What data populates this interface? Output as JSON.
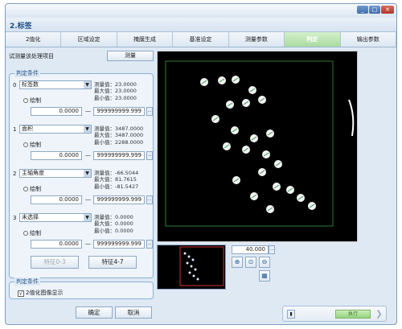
{
  "window": {
    "title": "2.标签",
    "controls": [
      "_",
      "□",
      "✕"
    ]
  },
  "tabs": [
    {
      "label": "2值化",
      "active": false
    },
    {
      "label": "区域设定",
      "active": false
    },
    {
      "label": "掩膜生成",
      "active": false
    },
    {
      "label": "基准设定",
      "active": false
    },
    {
      "label": "测量参数",
      "active": false
    },
    {
      "label": "判定",
      "active": true
    },
    {
      "label": "输出参数",
      "active": false
    }
  ],
  "measure": {
    "label": "试测量该处理项目",
    "button": "测量"
  },
  "judge": {
    "legend": "判定条件",
    "conditions": [
      {
        "index": "0",
        "item": "标签数",
        "measured": "测量值：23.0000",
        "max": "最大值：23.0000",
        "min": "最小值：23.0000",
        "draw": "绘制",
        "low": "0.0000",
        "high": "999999999.999"
      },
      {
        "index": "1",
        "item": "面积",
        "measured": "测量值：3487.0000",
        "max": "最大值：3487.0000",
        "min": "最小值：2288.0000",
        "draw": "绘制",
        "low": "0.0000",
        "high": "999999999.999"
      },
      {
        "index": "2",
        "item": "主轴角度",
        "measured": "测量值：-66.5044",
        "max": "最大值：81.7615",
        "min": "最小值：-81.5427",
        "draw": "绘制",
        "low": "0.0000",
        "high": "999999999.999"
      },
      {
        "index": "3",
        "item": "未选择",
        "measured": "测量值：0.0000",
        "max": "最大值：0.0000",
        "min": "最小值：0.0000",
        "draw": "绘制",
        "low": "0.0000",
        "high": "999999999.999"
      }
    ],
    "dash": "—",
    "feature_buttons": [
      "特征0-3",
      "特征4-7"
    ]
  },
  "display": {
    "legend": "判定条件",
    "checkbox_label": "2值化图像显示",
    "checked": "√"
  },
  "buttons": {
    "ok": "确定",
    "cancel": "取消"
  },
  "viewer": {
    "zoom": "40.000",
    "bottom_run": "执行"
  }
}
